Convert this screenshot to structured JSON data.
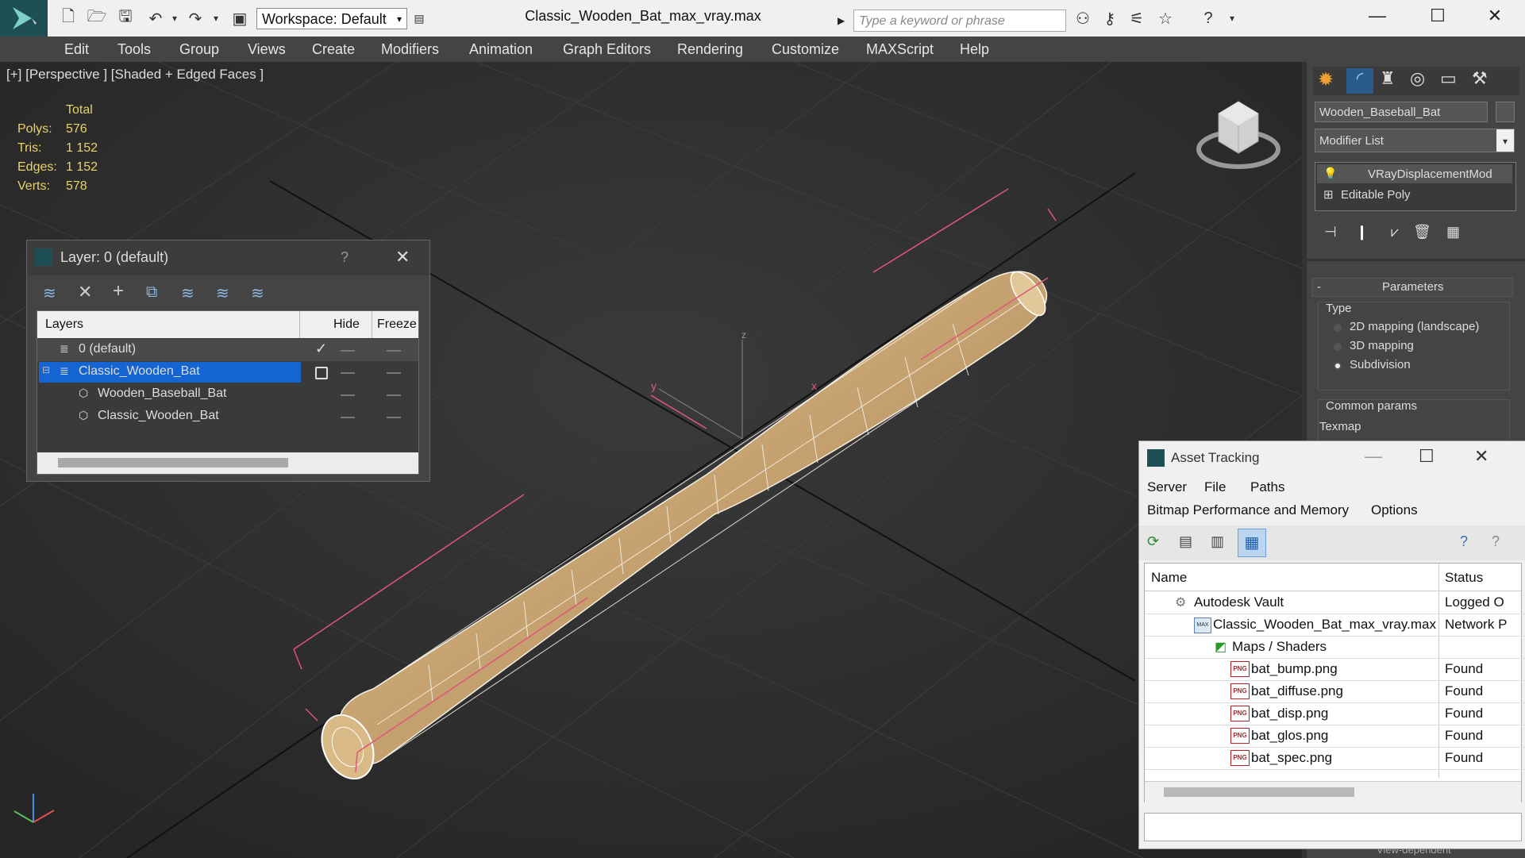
{
  "window": {
    "title": "Classic_Wooden_Bat_max_vray.max",
    "workspace": "Workspace: Default",
    "search_placeholder": "Type a keyword or phrase"
  },
  "menu": [
    "Edit",
    "Tools",
    "Group",
    "Views",
    "Create",
    "Modifiers",
    "Animation",
    "Graph Editors",
    "Rendering",
    "Customize",
    "MAXScript",
    "Help"
  ],
  "viewport": {
    "label": "[+] [Perspective ] [Shaded + Edged Faces ]",
    "stats": {
      "header": "Total",
      "rows": [
        {
          "label": "Polys:",
          "value": "576"
        },
        {
          "label": "Tris:",
          "value": "1 152"
        },
        {
          "label": "Edges:",
          "value": "1 152"
        },
        {
          "label": "Verts:",
          "value": "578"
        }
      ]
    }
  },
  "layer_dialog": {
    "title": "Layer: 0 (default)",
    "help": "?",
    "columns": {
      "layers": "Layers",
      "hide": "Hide",
      "freeze": "Freeze"
    },
    "rows": [
      {
        "name": "0 (default)"
      },
      {
        "name": "Classic_Wooden_Bat"
      },
      {
        "name": "Wooden_Baseball_Bat"
      },
      {
        "name": "Classic_Wooden_Bat"
      }
    ]
  },
  "command_panel": {
    "object_name": "Wooden_Baseball_Bat",
    "modifier_list": "Modifier List",
    "stack": [
      "VRayDisplacementMod",
      "Editable Poly"
    ],
    "parameters_header": "Parameters",
    "collapse": "-",
    "type_label": "Type",
    "type_options": [
      "2D mapping (landscape)",
      "3D mapping",
      "Subdivision"
    ],
    "common_params": "Common params",
    "texmap": "Texmap",
    "view_dependent": "View-dependent"
  },
  "asset_tracking": {
    "title": "Asset Tracking",
    "menu_row1": [
      "Server",
      "File",
      "Paths"
    ],
    "menu_row2": [
      "Bitmap Performance and Memory",
      "Options"
    ],
    "columns": {
      "name": "Name",
      "status": "Status"
    },
    "rows": [
      {
        "name": "Autodesk Vault",
        "status": "Logged O"
      },
      {
        "name": "Classic_Wooden_Bat_max_vray.max",
        "status": "Network P"
      },
      {
        "name": "Maps / Shaders",
        "status": ""
      },
      {
        "name": "bat_bump.png",
        "status": "Found"
      },
      {
        "name": "bat_diffuse.png",
        "status": "Found"
      },
      {
        "name": "bat_disp.png",
        "status": "Found"
      },
      {
        "name": "bat_glos.png",
        "status": "Found"
      },
      {
        "name": "bat_spec.png",
        "status": "Found"
      }
    ]
  },
  "gizmo_labels": {
    "x": "x",
    "y": "y",
    "z": "z"
  },
  "colors": {
    "accent": "#0a5bc4",
    "selection": "#1464d2",
    "stats": "#e8d36b",
    "wire": "#c9a57a"
  }
}
